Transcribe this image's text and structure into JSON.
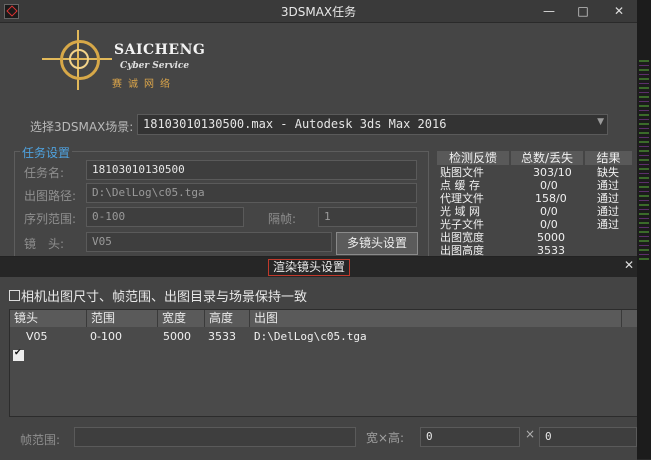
{
  "window": {
    "title": "3DSMAX任务",
    "minimize": "—",
    "maximize": "□",
    "close": "✕"
  },
  "logo": {
    "name": "SAICHENG",
    "subtitle": "Cyber Service",
    "chinese": "赛诚网络"
  },
  "scene": {
    "label": "选择3DSMAX场景:",
    "value": "18103010130500.max - Autodesk 3ds Max 2016",
    "arrow": "▼"
  },
  "task": {
    "legend": "任务设置",
    "name_label": "任务名:",
    "name_value": "18103010130500",
    "output_label": "出图路径:",
    "output_value": "D:\\DelLog\\c05.tga",
    "range_label": "序列范围:",
    "range_value": "0-100",
    "step_label": "隔帧:",
    "step_value": "1",
    "camera_label": "镜　头:",
    "camera_value": "V05",
    "multi_camera_button": "多镜头设置"
  },
  "check": {
    "headers": [
      "检测反馈",
      "总数/丢失",
      "结果"
    ],
    "rows": [
      {
        "item": "贴图文件",
        "count": "303/10",
        "result": "缺失"
      },
      {
        "item": "点 缓 存",
        "count": "0/0",
        "result": "通过"
      },
      {
        "item": "代理文件",
        "count": "158/0",
        "result": "通过"
      },
      {
        "item": "光 域 网",
        "count": "0/0",
        "result": "通过"
      },
      {
        "item": "光子文件",
        "count": "0/0",
        "result": "通过"
      },
      {
        "item": "出图宽度",
        "count": "5000",
        "result": ""
      },
      {
        "item": "出图高度",
        "count": "3533",
        "result": ""
      }
    ]
  },
  "dialog": {
    "title": "渲染镜头设置",
    "close": "✕",
    "keep_checkbox_label": "相机出图尺寸、帧范围、出图目录与场景保持一致",
    "columns": [
      "镜头",
      "范围",
      "宽度",
      "高度",
      "出图"
    ],
    "rows": [
      {
        "camera": "V05",
        "range": "0-100",
        "width": "5000",
        "height": "3533",
        "output": "D:\\DelLog\\c05.tga"
      }
    ],
    "frame_range_label": "帧范围:",
    "frame_range_value": "",
    "wh_label": "宽×高:",
    "width_value": "0",
    "times": "×",
    "height_value": "0"
  }
}
